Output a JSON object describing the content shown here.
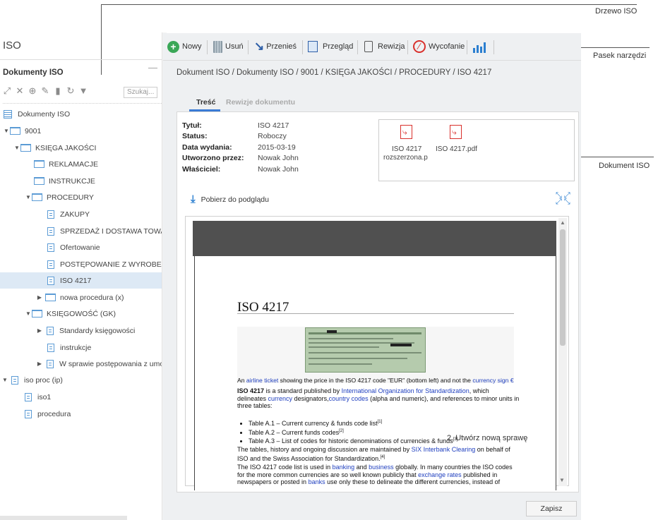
{
  "callouts": {
    "tree": "Drzewo ISO",
    "toolbar": "Pasek narzędzi",
    "document": "Dokument ISO"
  },
  "app": {
    "title": "ISO"
  },
  "tree": {
    "title": "Dokumenty ISO",
    "search_placeholder": "Szukaj...",
    "items": [
      {
        "label": "Dokumenty ISO",
        "type": "root"
      },
      {
        "label": "9001",
        "type": "folder"
      },
      {
        "label": "KSIĘGA JAKOŚCI",
        "type": "folder"
      },
      {
        "label": "REKLAMACJE",
        "type": "folder"
      },
      {
        "label": "INSTRUKCJE",
        "type": "folder"
      },
      {
        "label": "PROCEDURY",
        "type": "folder"
      },
      {
        "label": "ZAKUPY",
        "type": "doc"
      },
      {
        "label": "SPRZEDAŻ I DOSTAWA TOWARÓW",
        "type": "doc"
      },
      {
        "label": "Ofertowanie",
        "type": "doc"
      },
      {
        "label": "POSTĘPOWANIE Z WYROBEM NIEZGODNYM",
        "type": "doc"
      },
      {
        "label": "ISO 4217",
        "type": "doc"
      },
      {
        "label": "nowa procedura (x)",
        "type": "folder"
      },
      {
        "label": "KSIĘGOWOŚĆ (GK)",
        "type": "folder"
      },
      {
        "label": "Standardy księgowości",
        "type": "doc"
      },
      {
        "label": "instrukcje",
        "type": "doc"
      },
      {
        "label": "W sprawie postępowania z umowami",
        "type": "doc"
      },
      {
        "label": "iso proc (ip)",
        "type": "doc"
      },
      {
        "label": "iso1",
        "type": "doc"
      },
      {
        "label": "procedura",
        "type": "doc"
      }
    ]
  },
  "toolbar": {
    "new": "Nowy",
    "delete": "Usuń",
    "move": "Przenieś",
    "review": "Przegląd",
    "revision": "Rewizja",
    "withdraw": "Wycofanie"
  },
  "breadcrumb": "Dokument ISO / Dokumenty ISO / 9001 / KSIĘGA JAKOŚCI / PROCEDURY / ISO 4217",
  "tabs": {
    "content": "Treść",
    "revisions": "Rewizje dokumentu"
  },
  "meta": {
    "title_label": "Tytuł:",
    "title_value": "ISO 4217",
    "status_label": "Status:",
    "status_value": "Roboczy",
    "date_label": "Data wydania:",
    "date_value": "2015-03-19",
    "created_label": "Utworzono przez:",
    "created_value": "Nowak John",
    "owner_label": "Właściciel:",
    "owner_value": "Nowak John"
  },
  "attachments": [
    {
      "name1": "ISO 4217",
      "name2": "rozszerzona.p"
    },
    {
      "name1": "ISO 4217.pdf",
      "name2": ""
    }
  ],
  "download_label": "Pobierz do podglądu",
  "preview": {
    "heading": "ISO 4217",
    "caption_pre": "An ",
    "caption_link1": "airline ticket",
    "caption_mid": " showing the price in the ISO 4217 code \"EUR\" (bottom left) and not the ",
    "caption_link2": "currency sign €",
    "p1_bold": "ISO 4217",
    "p1_a": " is a standard published by ",
    "p1_link1": "International Organization for Standardization",
    "p1_b": ", which delineates ",
    "p1_link2": "currency",
    "p1_c": " designators,",
    "p1_link3": "country codes",
    "p1_d": " (alpha and numeric), and references to minor units in three tables:",
    "li1": "Table A.1 – Current currency & funds code list",
    "li1_sup": "[1]",
    "li2": "Table A.2 – Current funds codes",
    "li2_sup": "[2]",
    "li3": "Table A.3 – List of codes for historic denominations of currencies & funds",
    "li3_sup": "[3]",
    "p2_a": "The tables, history and ongoing discussion are maintained by ",
    "p2_link": "SIX Interbank Clearing",
    "p2_b": " on behalf of ISO and the Swiss Association for Standardization.",
    "p2_sup": "[4]",
    "p3_a": "The ISO 4217 code list is used in ",
    "p3_link1": "banking",
    "p3_b": " and ",
    "p3_link2": "business",
    "p3_c": " globally. In many countries the ISO codes for the more common currencies are so well known publicly that ",
    "p3_link3": "exchange rates",
    "p3_d": " published in newspapers or posted in ",
    "p3_link4": "banks",
    "p3_e": " use only these to delineate the different currencies, instead of"
  },
  "overlay_text": "2. Utwórz nową sprawę",
  "save_label": "Zapisz",
  "colors": {
    "accent": "#3a7bd5",
    "new_green": "#3aa757",
    "withdraw_red": "#d9302c"
  }
}
